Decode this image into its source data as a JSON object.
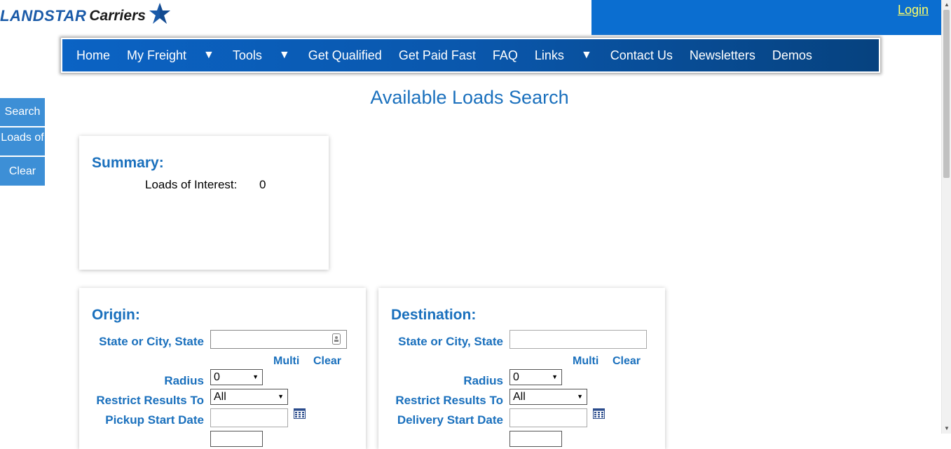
{
  "header": {
    "logo_primary": "LANDSTAR",
    "logo_secondary": "Carriers",
    "login_label": "Login",
    "login_bar_color": "#0b6ed0",
    "link_color": "#ffff66"
  },
  "nav": {
    "items": [
      {
        "label": "Home"
      },
      {
        "label": "My Freight",
        "dropdown": true
      },
      {
        "label": "Tools",
        "dropdown": true
      },
      {
        "label": "Get Qualified"
      },
      {
        "label": "Get Paid Fast"
      },
      {
        "label": "FAQ"
      },
      {
        "label": "Links",
        "dropdown": true
      },
      {
        "label": "Contact Us"
      },
      {
        "label": "Newsletters"
      },
      {
        "label": "Demos"
      }
    ],
    "dropdown_glyph": "▼"
  },
  "page": {
    "title": "Available Loads Search",
    "accent_color": "#1a70bd"
  },
  "side_buttons": {
    "search": "Search",
    "loads_of_interest": "Loads of",
    "clear": "Clear"
  },
  "summary": {
    "title": "Summary:",
    "loads_of_interest_label": "Loads of Interest:",
    "loads_of_interest_value": "0"
  },
  "origin": {
    "title": "Origin:",
    "state_city_label": "State or City, State",
    "state_city_value": "",
    "multi_label": "Multi",
    "clear_label": "Clear",
    "radius_label": "Radius",
    "radius_value": "0",
    "restrict_label": "Restrict Results To",
    "restrict_value": "All",
    "date_label": "Pickup Start Date",
    "date_value": ""
  },
  "destination": {
    "title": "Destination:",
    "state_city_label": "State or City, State",
    "state_city_value": "",
    "multi_label": "Multi",
    "clear_label": "Clear",
    "radius_label": "Radius",
    "radius_value": "0",
    "restrict_label": "Restrict Results To",
    "restrict_value": "All",
    "date_label": "Delivery Start Date",
    "date_value": ""
  }
}
